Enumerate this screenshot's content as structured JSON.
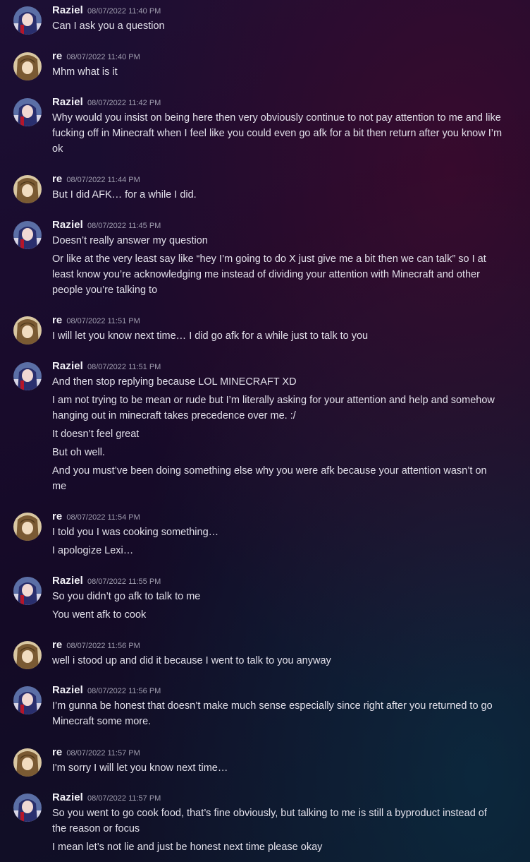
{
  "messages": [
    {
      "author": "Raziel",
      "time": "08/07/2022 11:40 PM",
      "lines": [
        "Can I ask you a question"
      ]
    },
    {
      "author": "re",
      "time": "08/07/2022 11:40 PM",
      "lines": [
        "Mhm what is it"
      ]
    },
    {
      "author": "Raziel",
      "time": "08/07/2022 11:42 PM",
      "lines": [
        "Why would you insist on being here then very obviously continue to not pay attention to me and like fucking off in Minecraft when I feel like you could even go afk for a bit then return after you know I’m ok"
      ]
    },
    {
      "author": "re",
      "time": "08/07/2022 11:44 PM",
      "lines": [
        "But I did AFK… for a while I did."
      ]
    },
    {
      "author": "Raziel",
      "time": "08/07/2022 11:45 PM",
      "lines": [
        "Doesn’t really answer my question",
        "Or like at the very least say like “hey I’m going to do X just give me a bit then we can talk” so I at least know you’re acknowledging me instead of dividing your attention with Minecraft and other people you’re talking to"
      ]
    },
    {
      "author": "re",
      "time": "08/07/2022 11:51 PM",
      "lines": [
        "I will let you know next time… I did go afk for a while  just to talk to you"
      ]
    },
    {
      "author": "Raziel",
      "time": "08/07/2022 11:51 PM",
      "lines": [
        "And then stop replying because LOL MINECRAFT XD",
        "I am not trying to be mean or rude but I’m literally asking for your attention and help and somehow hanging out in minecraft takes precedence over me. :/",
        "It doesn’t feel great",
        "But oh well.",
        "And you must’ve been doing something else why you were afk because your attention wasn’t on me"
      ]
    },
    {
      "author": "re",
      "time": "08/07/2022 11:54 PM",
      "lines": [
        "I told you I was cooking something…",
        "I apologize Lexi…"
      ]
    },
    {
      "author": "Raziel",
      "time": "08/07/2022 11:55 PM",
      "lines": [
        "So you didn’t go afk to talk to me",
        "You went afk to cook"
      ]
    },
    {
      "author": "re",
      "time": "08/07/2022 11:56 PM",
      "lines": [
        "well i stood up and did it because I went to talk to you anyway"
      ]
    },
    {
      "author": "Raziel",
      "time": "08/07/2022 11:56 PM",
      "lines": [
        "I’m gunna be honest that doesn’t make much sense especially since right after you returned to go Minecraft some more."
      ]
    },
    {
      "author": "re",
      "time": "08/07/2022 11:57 PM",
      "lines": [
        "I'm sorry I will let you know next time…"
      ]
    },
    {
      "author": "Raziel",
      "time": "08/07/2022 11:57 PM",
      "lines": [
        "So you went to go cook food, that’s fine obviously, but talking to me is still a byproduct instead of the reason or focus",
        "I mean let’s not lie and just be honest next time please okay"
      ]
    }
  ]
}
